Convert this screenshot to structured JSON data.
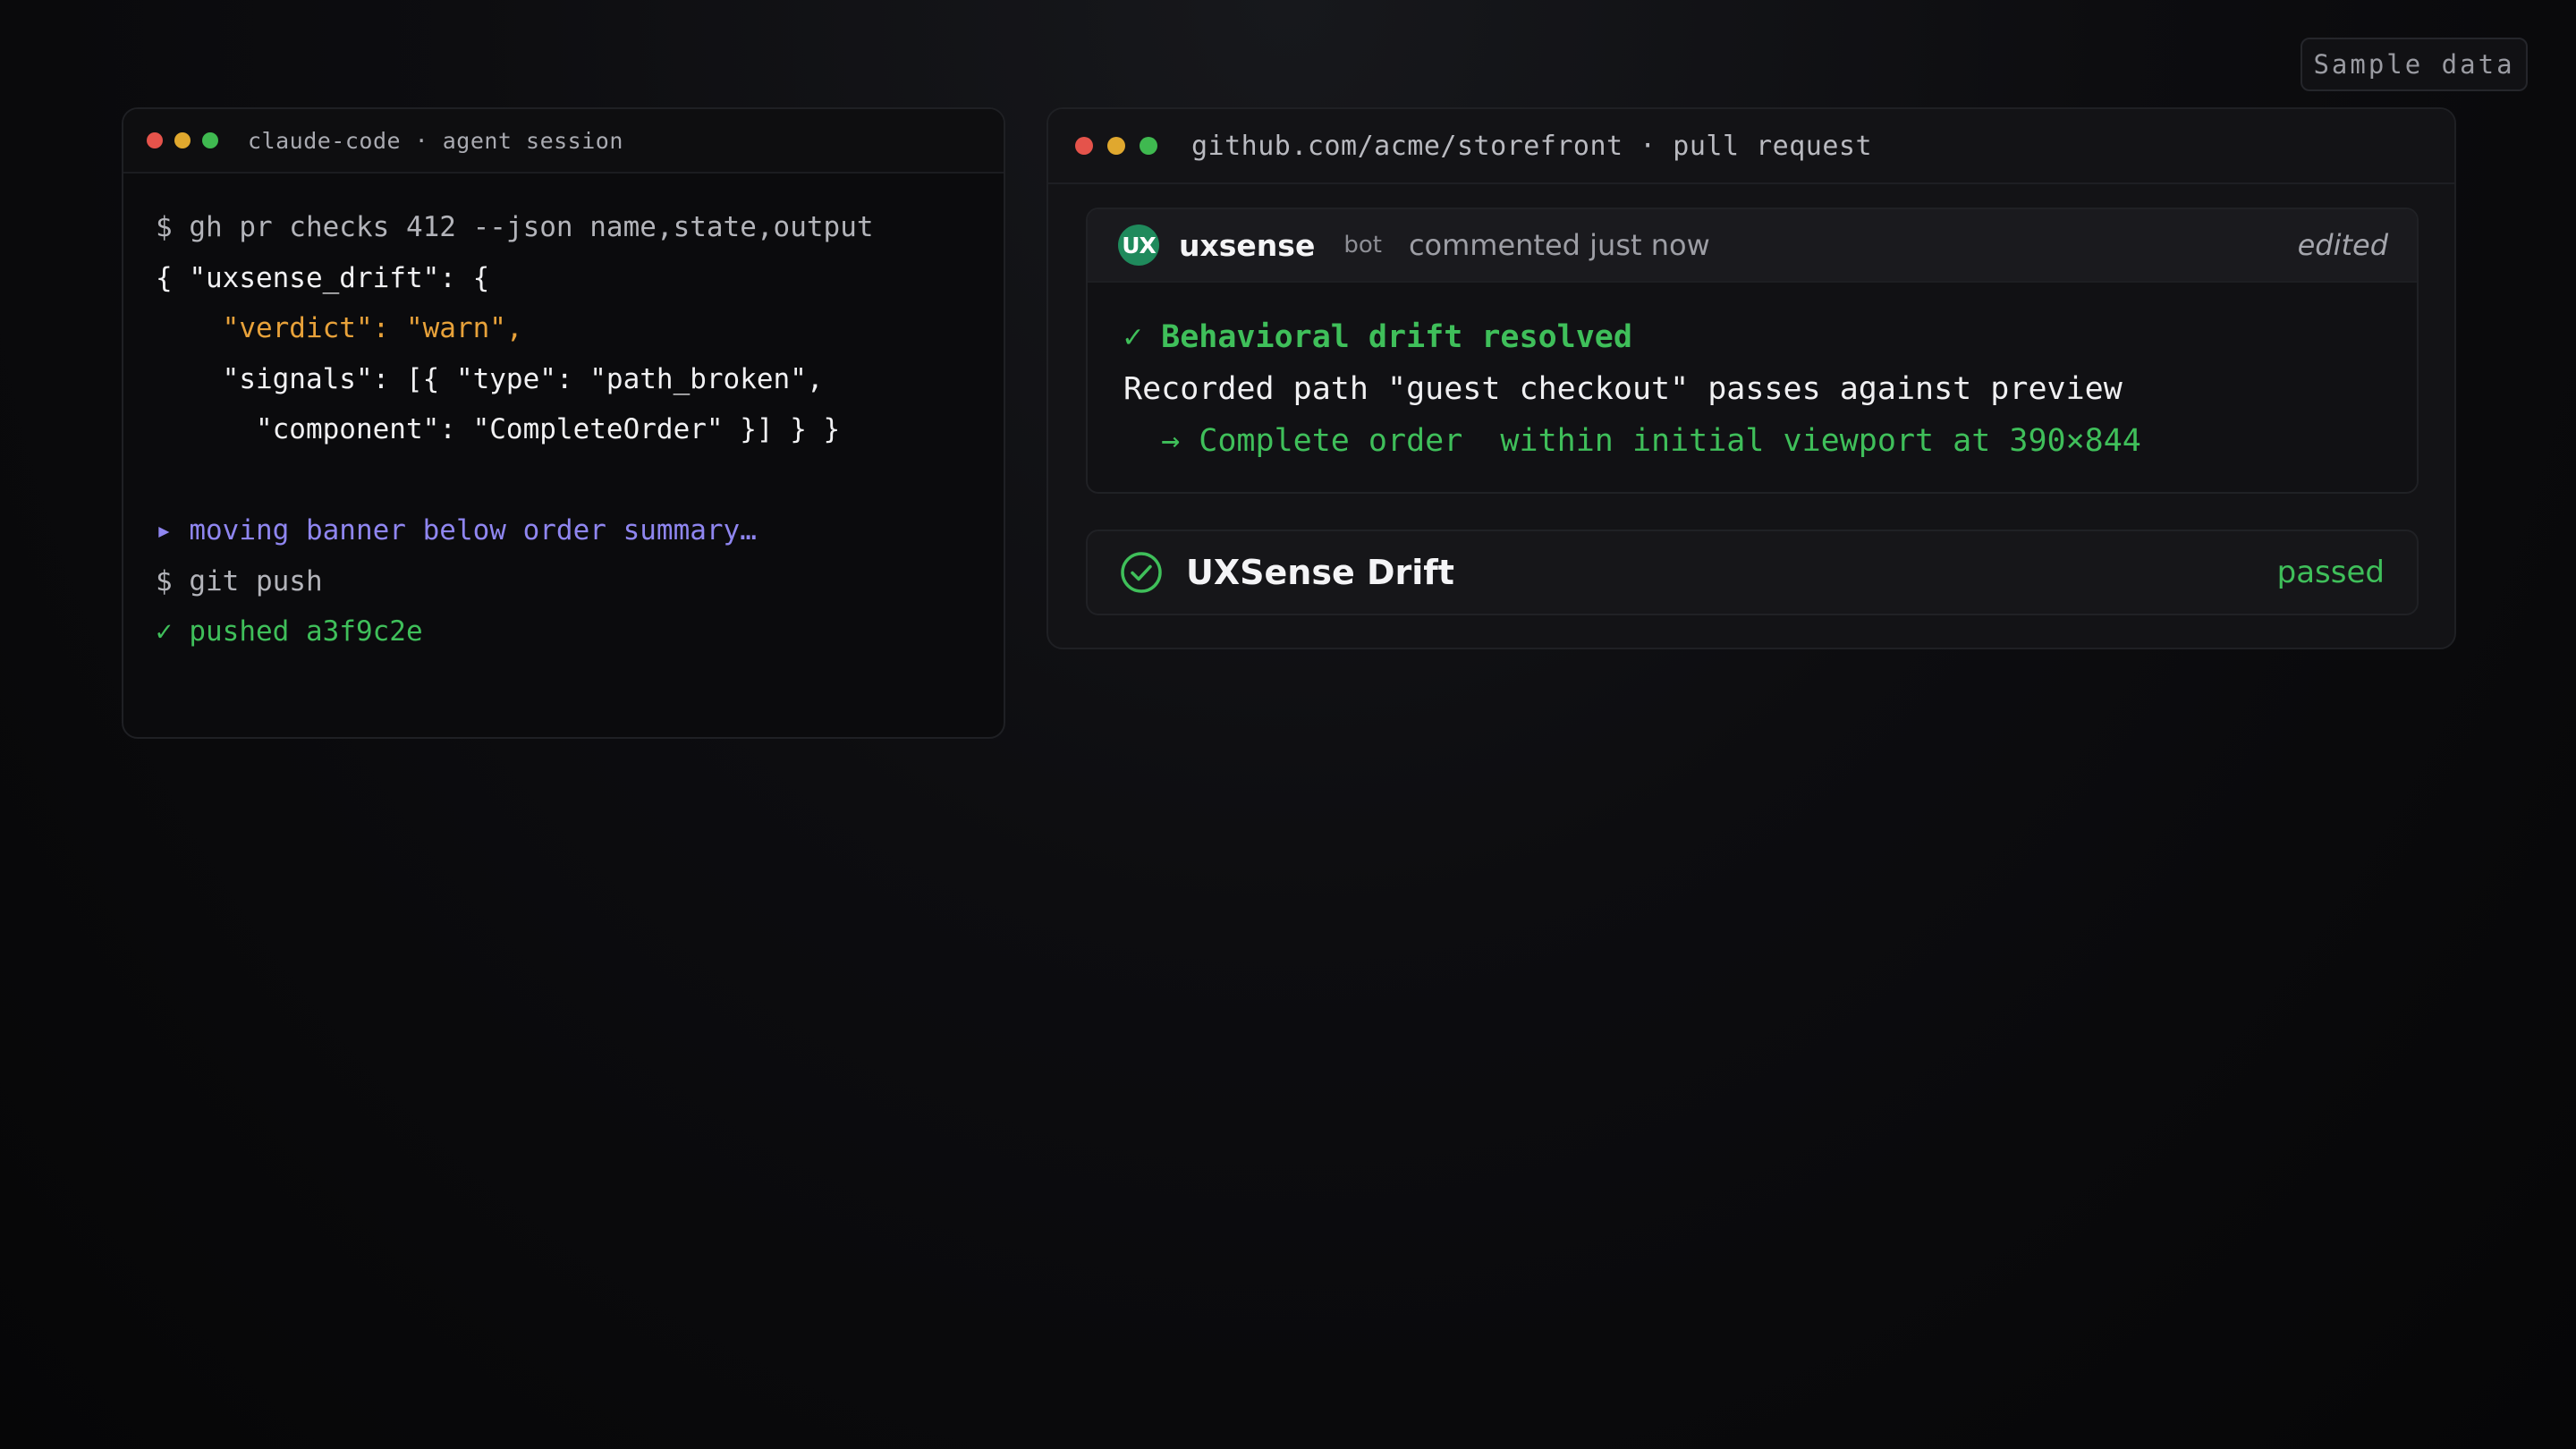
{
  "badge": {
    "label": "Sample data"
  },
  "terminal": {
    "title": "claude-code · agent session",
    "lines": [
      {
        "text": "$ gh pr checks 412 --json name,state,output"
      },
      {
        "text": "{ \"uxsense_drift\": {"
      },
      {
        "text": "    \"verdict\": \"warn\","
      },
      {
        "text": "    \"signals\": [{ \"type\": \"path_broken\","
      },
      {
        "text": "      \"component\": \"CompleteOrder\" }] } }"
      },
      {
        "text": ""
      },
      {
        "text": "▸ moving banner below order summary…"
      },
      {
        "text": "$ git push"
      },
      {
        "text": "✓ pushed a3f9c2e"
      }
    ]
  },
  "github": {
    "title": "github.com/acme/storefront · pull request",
    "comment": {
      "avatar_initials": "UX",
      "author": "uxsense",
      "bot_tag": "bot",
      "action": "commented just now",
      "edited": "edited",
      "heading": "✓ Behavioral drift resolved",
      "body": "Recorded path \"guest checkout\" passes against preview",
      "detail": "  → Complete order  within initial viewport at 390×844"
    },
    "check": {
      "icon": "check-circle-icon",
      "name": "UXSense Drift",
      "status": "passed"
    }
  },
  "colors": {
    "accent_green": "#3fbf5a",
    "warn_orange": "#e8a23a",
    "agent_purple": "#8f86f0",
    "avatar_green": "#1f8a5c"
  }
}
